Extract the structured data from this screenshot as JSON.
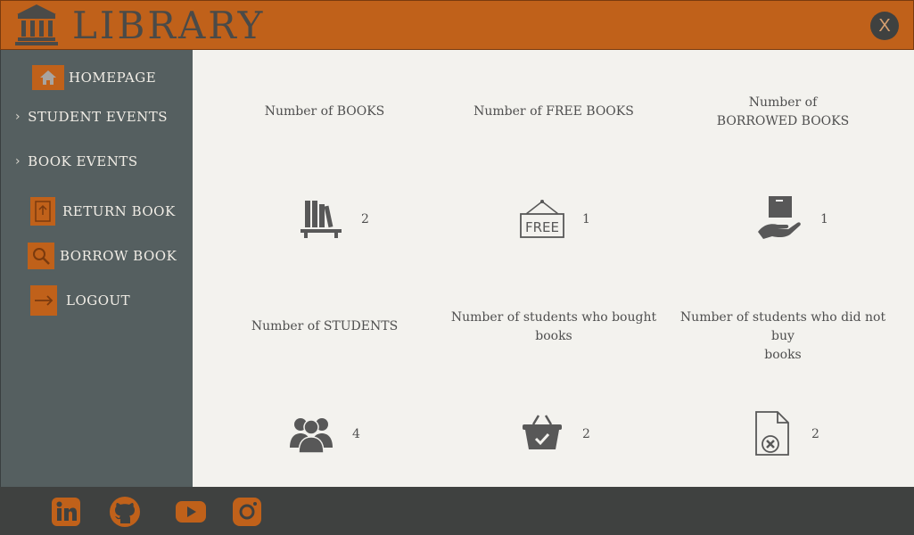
{
  "app": {
    "title": "LIBRARY",
    "close_label": "X",
    "colors": {
      "accent": "#c0611a",
      "sidebar": "#555f60",
      "content_bg": "#f3f2ee",
      "footer": "#3f4140",
      "icon": "#585858"
    }
  },
  "sidebar": {
    "items": [
      {
        "label": "HOMEPAGE",
        "icon": "home-icon"
      },
      {
        "label": "STUDENT EVENTS",
        "icon": "chevron-right-icon"
      },
      {
        "label": "BOOK EVENTS",
        "icon": "chevron-right-icon"
      },
      {
        "label": "RETURN BOOK",
        "icon": "book-return-icon"
      },
      {
        "label": "BORROW BOOK",
        "icon": "search-icon"
      },
      {
        "label": "LOGOUT",
        "icon": "logout-icon"
      }
    ]
  },
  "stats": [
    {
      "label_line1": "Number of BOOKS",
      "label_line2": "",
      "value": "2",
      "icon": "bookshelf-icon"
    },
    {
      "label_line1": "Number of FREE BOOKS",
      "label_line2": "",
      "value": "1",
      "icon": "free-sign-icon"
    },
    {
      "label_line1": "Number of",
      "label_line2": "BORROWED BOOKS",
      "value": "1",
      "icon": "hand-box-icon"
    },
    {
      "label_line1": "Number of STUDENTS",
      "label_line2": "",
      "value": "4",
      "icon": "users-icon"
    },
    {
      "label_line1": "Number of students who bought",
      "label_line2": "books",
      "value": "2",
      "icon": "basket-check-icon"
    },
    {
      "label_line1": "Number of students who did not buy",
      "label_line2": "books",
      "value": "2",
      "icon": "file-x-icon"
    }
  ],
  "footer": {
    "social": [
      "linkedin-icon",
      "github-icon",
      "youtube-icon",
      "instagram-icon"
    ]
  }
}
